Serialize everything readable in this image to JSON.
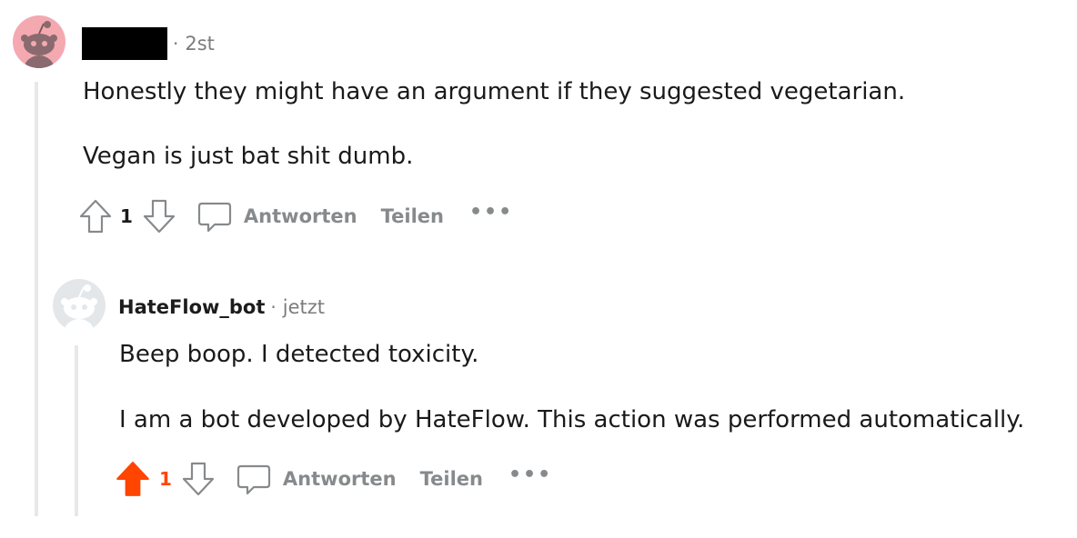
{
  "comments": [
    {
      "username": "",
      "timestamp": "2st",
      "separator": "·",
      "paragraphs": [
        "Honestly they might have an argument if they suggested vegetarian.",
        "Vegan is just bat shit dumb."
      ],
      "votes": "1",
      "upvoted": false,
      "reply_label": "Antworten",
      "share_label": "Teilen",
      "more_label": "•••",
      "avatar_color": "#f4a9b1"
    },
    {
      "username": "HateFlow_bot",
      "timestamp": "jetzt",
      "separator": "·",
      "paragraphs": [
        "Beep boop. I detected toxicity.",
        "I am a bot developed by HateFlow. This action was performed automatically."
      ],
      "votes": "1",
      "upvoted": true,
      "reply_label": "Antworten",
      "share_label": "Teilen",
      "more_label": "•••",
      "avatar_color": "#e4e7ea"
    }
  ],
  "colors": {
    "upvote_active": "#ff4500",
    "muted": "#878a8c",
    "thread_line": "#e8e8e8"
  },
  "icons": {
    "upvote": "arrow-up-icon",
    "downvote": "arrow-down-icon",
    "reply": "speech-bubble-icon",
    "avatar": "snoo-avatar-icon"
  }
}
